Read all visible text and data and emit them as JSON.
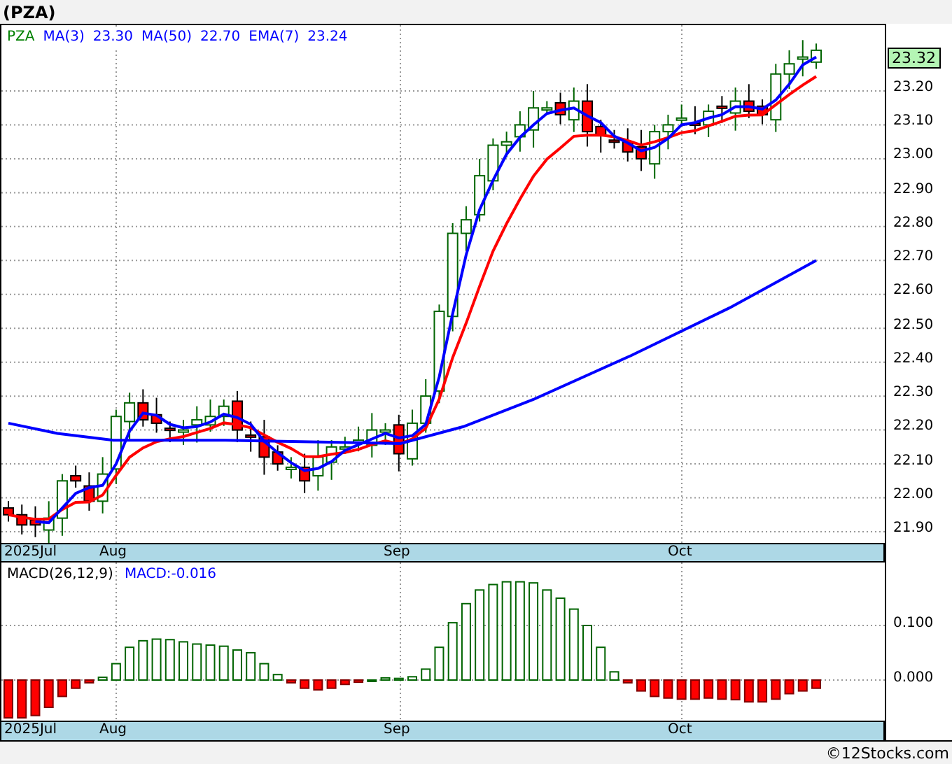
{
  "title": "(PZA)",
  "legend": [
    {
      "label": "PZA",
      "color": "#008000"
    },
    {
      "label": "MA(3)",
      "color": "#0000ff"
    },
    {
      "label": "23.30",
      "color": "#0000ff"
    },
    {
      "label": "MA(50)",
      "color": "#0000ff"
    },
    {
      "label": "22.70",
      "color": "#0000ff"
    },
    {
      "label": "EMA(7)",
      "color": "#0000ff"
    },
    {
      "label": "23.24",
      "color": "#0000ff"
    }
  ],
  "last_price": "23.32",
  "price_ticks": [
    "23.20",
    "23.10",
    "23.00",
    "22.90",
    "22.80",
    "22.70",
    "22.60",
    "22.50",
    "22.40",
    "22.30",
    "22.20",
    "22.10",
    "22.00",
    "21.90"
  ],
  "x_axis": [
    "2025Jul",
    "Aug",
    "Sep",
    "Oct"
  ],
  "macd_legend": [
    {
      "label": "MACD(26,12,9)",
      "color": "#000000"
    },
    {
      "label": "MACD:-0.016",
      "color": "#0000ff"
    }
  ],
  "macd_ticks": [
    "0.100",
    "0.000"
  ],
  "macd_x_axis": [
    "2025Jul",
    "Aug",
    "Sep",
    "Oct"
  ],
  "footer": "©12Stocks.com"
}
